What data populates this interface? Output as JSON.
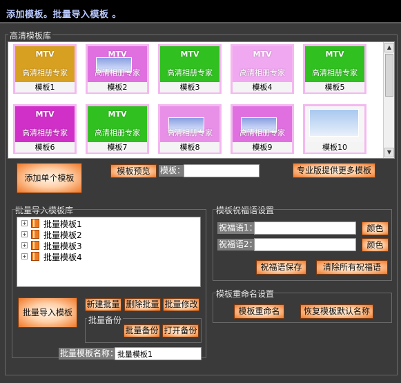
{
  "window": {
    "title": "添加模板。批量导入模板 。"
  },
  "hd_library": {
    "group_label": "高清模板库",
    "templates": [
      {
        "name": "模板1",
        "mtv": "MTV",
        "subtitle": "高清相册专家",
        "color": "#d8a020"
      },
      {
        "name": "模板2",
        "mtv": "MTV",
        "subtitle": "高清相册专家",
        "color": "#e070e0"
      },
      {
        "name": "模板3",
        "mtv": "MTV",
        "subtitle": "高清相册专家",
        "color": "#30c020"
      },
      {
        "name": "模板4",
        "mtv": "MTV",
        "subtitle": "高清相册专家",
        "color": "#f0a8f0"
      },
      {
        "name": "模板5",
        "mtv": "MTV",
        "subtitle": "高清相册专家",
        "color": "#30c020"
      },
      {
        "name": "模板6",
        "mtv": "MTV",
        "subtitle": "高清相册专家",
        "color": "#d030c8"
      },
      {
        "name": "模板7",
        "mtv": "MTV",
        "subtitle": "高清相册专家",
        "color": "#30c020"
      },
      {
        "name": "模板8",
        "mtv": "",
        "subtitle": "高清相册专家",
        "color": "#e890e8"
      },
      {
        "name": "模板9",
        "mtv": "",
        "subtitle": "高清相册专家",
        "color": "#e070e0"
      },
      {
        "name": "模板10",
        "mtv": "",
        "subtitle": "",
        "color": "#f6f6f6"
      }
    ]
  },
  "toolbar": {
    "add_single": "添加单个模板",
    "preview": "模板预览",
    "template_label": "模板：",
    "template_value": "",
    "pro_more": "专业版提供更多模板"
  },
  "batch_library": {
    "group_label": "批量导入模板库",
    "items": [
      {
        "label": "批量模板1",
        "expander": "+"
      },
      {
        "label": "批量模板2",
        "expander": "+"
      },
      {
        "label": "批量模板3",
        "expander": "+"
      },
      {
        "label": "批量模板4",
        "expander": "+"
      }
    ],
    "import_button": "批量导入模板",
    "new_button": "新建批量",
    "delete_button": "删除批量",
    "edit_button": "批量修改",
    "backup_label": "批量备份",
    "backup_button": "批量备份",
    "open_backup_button": "打开备份",
    "name_label": "批量模板名称：",
    "name_value": "批量模板1"
  },
  "greeting": {
    "group_label": "模板祝福语设置",
    "label1": "祝福语1：",
    "value1": "",
    "label2": "祝福语2：",
    "value2": "",
    "color_button": "颜色",
    "save_button": "祝福语保存",
    "clear_button": "清除所有祝福语"
  },
  "rename": {
    "group_label": "模板重命名设置",
    "rename_button": "模板重命名",
    "restore_button": "恢复模板默认名称"
  }
}
